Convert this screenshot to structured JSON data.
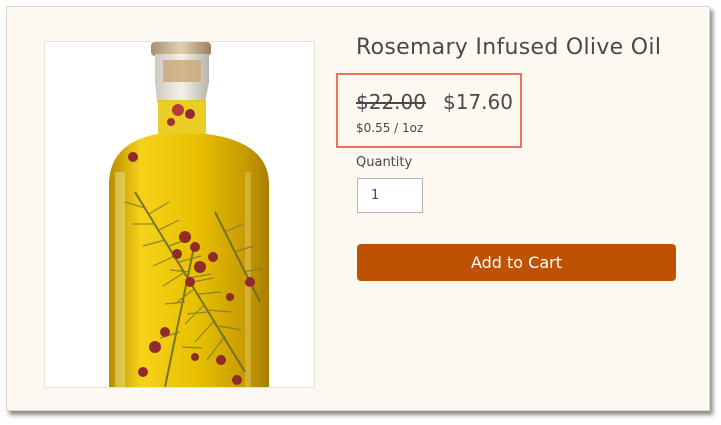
{
  "product": {
    "title": "Rosemary Infused Olive Oil",
    "original_price": "$22.00",
    "sale_price": "$17.60",
    "unit_price": "$0.55 / 1oz",
    "image_icon": "olive-oil-bottle"
  },
  "quantity": {
    "label": "Quantity",
    "value": "1"
  },
  "add_to_cart": {
    "label": "Add to Cart"
  },
  "colors": {
    "background": "#fdf9f1",
    "button": "#bf5200",
    "highlight": "#ec7357",
    "text": "#4a4848"
  }
}
